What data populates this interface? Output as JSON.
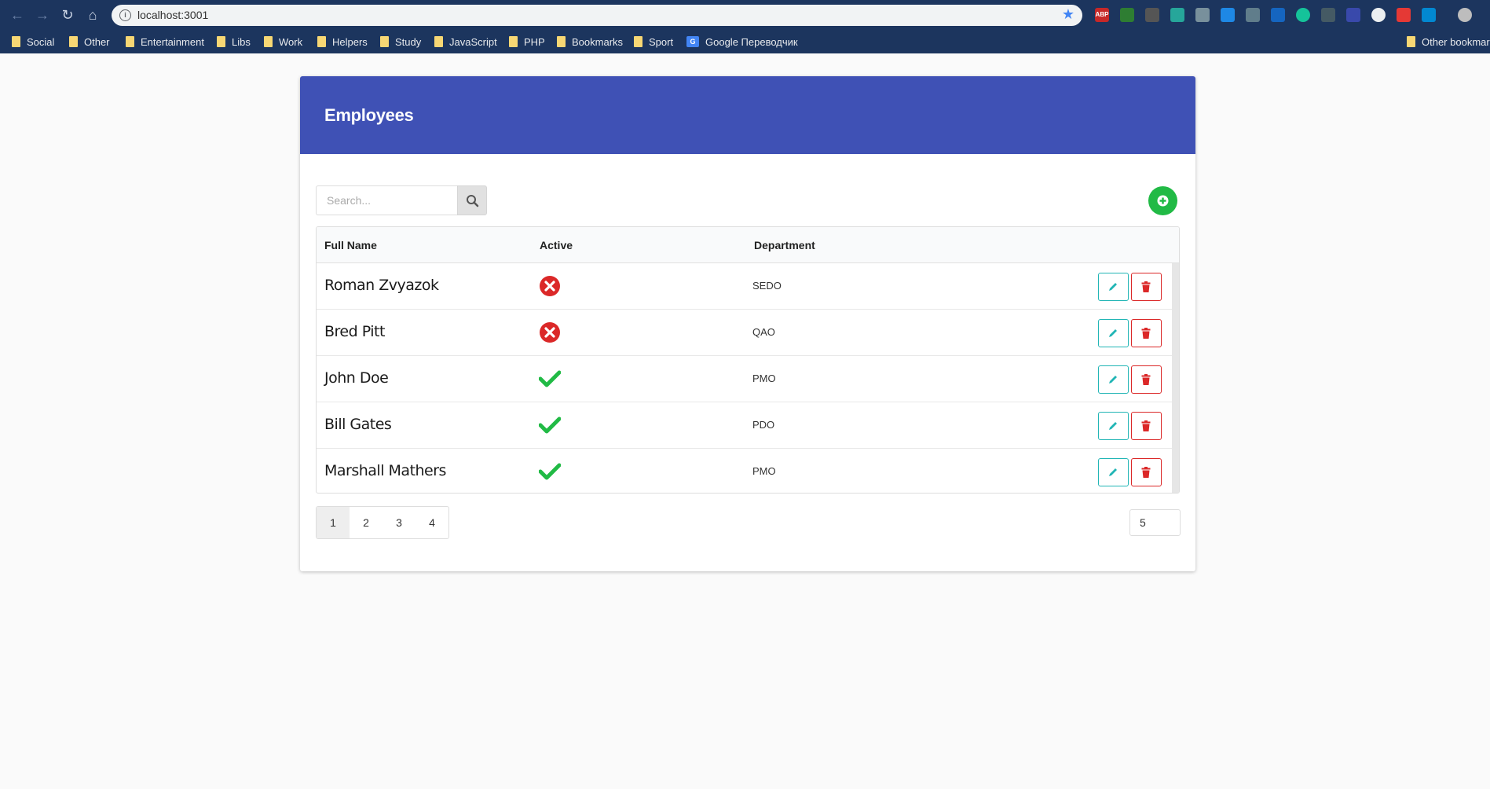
{
  "browser": {
    "url": "localhost:3001",
    "bookmarks": [
      "Social",
      "Other",
      "Entertainment",
      "Libs",
      "Work",
      "Helpers",
      "Study",
      "JavaScript",
      "PHP",
      "Bookmarks",
      "Sport",
      "Google Переводчик"
    ],
    "other_bookmarks": "Other bookmarks"
  },
  "page": {
    "title": "Employees",
    "search_placeholder": "Search...",
    "table": {
      "headers": [
        "Full Name",
        "Active",
        "Department"
      ],
      "rows": [
        {
          "name": "Roman Zvyazok",
          "active": false,
          "department": "SEDO"
        },
        {
          "name": "Bred Pitt",
          "active": false,
          "department": "QAO"
        },
        {
          "name": "John Doe",
          "active": true,
          "department": "PMO"
        },
        {
          "name": "Bill Gates",
          "active": true,
          "department": "PDO"
        },
        {
          "name": "Marshall Mathers",
          "active": true,
          "department": "PMO"
        }
      ]
    },
    "pagination": [
      "1",
      "2",
      "3",
      "4"
    ],
    "current_page": "1",
    "page_size": "5"
  },
  "colors": {
    "header": "#3f51b5",
    "add": "#21ba45",
    "edit": "#21b5b5",
    "delete": "#db2828",
    "inactive": "#db2828",
    "active": "#21ba45"
  }
}
